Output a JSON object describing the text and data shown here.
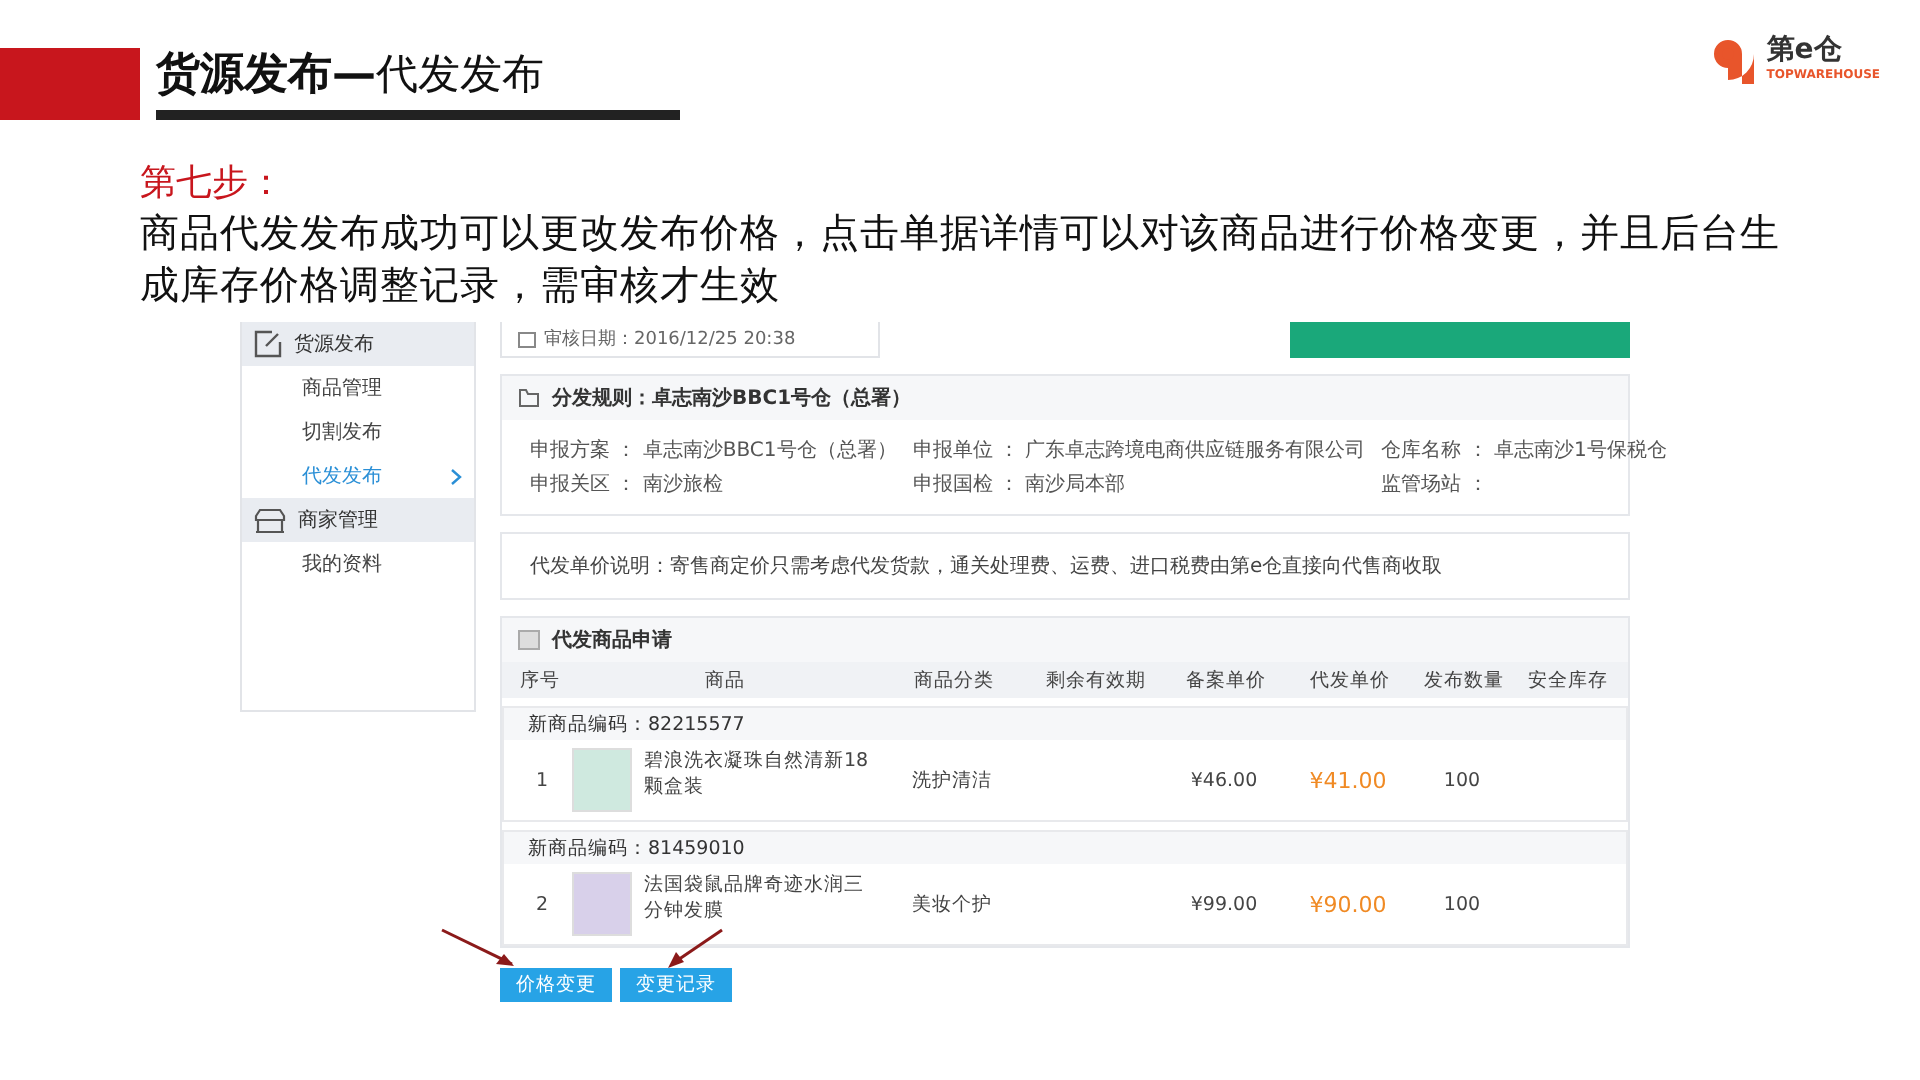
{
  "header": {
    "title": "**货源发布—**代发发布",
    "logo_text": "第e仓",
    "logo_tagline": "TOPWAREHOUSE"
  },
  "step": {
    "label": "第七步：",
    "text": "商品代发发布成功可以更改发布价格，点击单据详情可以对该商品进行价格变更，并且后台生成库存价格调整记录，需审核才生效"
  },
  "embedded_screen": {
    "sidebar": [
      {
        "label": "货源发布",
        "children": [
          {
            "label": "商品管理",
            "selected": false
          },
          {
            "label": "切割发布",
            "selected": false
          },
          {
            "label": "代发发布",
            "selected": true
          }
        ]
      },
      {
        "label": "商家管理",
        "children": [
          {
            "label": "我的资料",
            "selected": false
          }
        ]
      }
    ],
    "top_card": {
      "text": "审核日期：2016/12/25 20:38"
    },
    "rule": {
      "title": "分发规则：卓志南沙BBC1号仓（总署）",
      "fields": [
        {
          "label": "申报方案 ：",
          "value": "卓志南沙BBC1号仓（总署）"
        },
        {
          "label": "申报单位 ：",
          "value": "广东卓志跨境电商供应链服务有限公司"
        },
        {
          "label": "仓库名称 ：",
          "value": "卓志南沙1号保税仓"
        },
        {
          "label": "申报关区 ：",
          "value": "南沙旅检"
        },
        {
          "label": "申报国检 ：",
          "value": "南沙局本部"
        },
        {
          "label": "监管场站 ："
        }
      ]
    },
    "note": "代发单价说明：寄售商定价只需考虑代发货款，通关处理费、运费、进口税费由第e仓直接向代售商收取",
    "products": {
      "title": "代发商品申请",
      "columns": [
        "序号",
        "商品",
        "商品分类",
        "剩余有效期",
        "备案单价",
        "代发单价",
        "发布数量",
        "安全库存"
      ],
      "rows": [
        {
          "code": "新商品编码：82215577",
          "index": "1",
          "name": "碧浪洗衣凝珠自然清新18颗盒装",
          "category": "洗护清洁",
          "filing_price": "¥46.00",
          "price": "¥41.00",
          "quantity": "100"
        },
        {
          "code": "新商品编码：81459010",
          "index": "2",
          "name": "法国袋鼠品牌奇迹水润三分钟发膜",
          "category": "美妆个护",
          "filing_price": "¥99.00",
          "price": "¥90.00",
          "quantity": "100"
        }
      ]
    },
    "buttons": [
      "价格变更",
      "变更记录"
    ]
  }
}
